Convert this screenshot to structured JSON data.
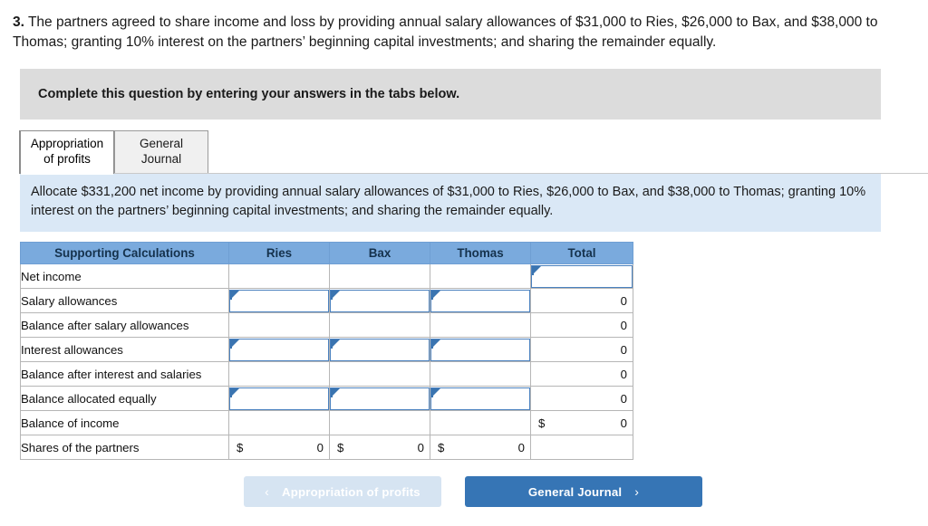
{
  "question": {
    "number": "3.",
    "text": "The partners agreed to share income and loss by providing annual salary allowances of $31,000 to Ries, $26,000 to Bax, and $38,000 to Thomas; granting 10% interest on the partners’ beginning capital investments; and sharing the remainder equally."
  },
  "banner": {
    "text": "Complete this question by entering your answers in the tabs below."
  },
  "tabs": [
    {
      "label_line1": "Appropriation",
      "label_line2": "of profits",
      "active": true
    },
    {
      "label_line1": "General",
      "label_line2": "Journal",
      "active": false
    }
  ],
  "instruction": {
    "text": "Allocate $331,200 net income by providing annual salary allowances of $31,000 to Ries, $26,000 to Bax, and $38,000 to Thomas; granting 10% interest on the partners’ beginning capital investments; and sharing the remainder equally."
  },
  "table": {
    "headers": [
      "Supporting Calculations",
      "Ries",
      "Bax",
      "Thomas",
      "Total"
    ],
    "rows": [
      {
        "label": "Net income",
        "ries": {
          "kind": "blank",
          "value": ""
        },
        "bax": {
          "kind": "blank",
          "value": ""
        },
        "thomas": {
          "kind": "blank",
          "value": ""
        },
        "total": {
          "kind": "input",
          "value": ""
        }
      },
      {
        "label": "Salary allowances",
        "ries": {
          "kind": "input",
          "value": ""
        },
        "bax": {
          "kind": "input",
          "value": ""
        },
        "thomas": {
          "kind": "input",
          "value": ""
        },
        "total": {
          "kind": "readonly",
          "value": "0"
        }
      },
      {
        "label": "Balance after salary allowances",
        "ries": {
          "kind": "blank",
          "value": ""
        },
        "bax": {
          "kind": "blank",
          "value": ""
        },
        "thomas": {
          "kind": "blank",
          "value": ""
        },
        "total": {
          "kind": "readonly",
          "value": "0",
          "underline": "dark"
        }
      },
      {
        "label": "Interest allowances",
        "ries": {
          "kind": "input",
          "value": ""
        },
        "bax": {
          "kind": "input",
          "value": ""
        },
        "thomas": {
          "kind": "input",
          "value": ""
        },
        "total": {
          "kind": "readonly",
          "value": "0"
        }
      },
      {
        "label": "Balance after interest and salaries",
        "ries": {
          "kind": "blank",
          "value": ""
        },
        "bax": {
          "kind": "blank",
          "value": ""
        },
        "thomas": {
          "kind": "blank",
          "value": ""
        },
        "total": {
          "kind": "readonly",
          "value": "0"
        }
      },
      {
        "label": "Balance allocated equally",
        "ries": {
          "kind": "input",
          "value": ""
        },
        "bax": {
          "kind": "input",
          "value": ""
        },
        "thomas": {
          "kind": "input",
          "value": ""
        },
        "total": {
          "kind": "readonly",
          "value": "0"
        }
      },
      {
        "label": "Balance of income",
        "ries": {
          "kind": "blank",
          "value": ""
        },
        "bax": {
          "kind": "blank",
          "value": ""
        },
        "thomas": {
          "kind": "blank",
          "value": ""
        },
        "total": {
          "kind": "money",
          "currency": "$",
          "value": "0",
          "underline": "dark"
        }
      },
      {
        "label": "Shares of the partners",
        "ries": {
          "kind": "money",
          "currency": "$",
          "value": "0",
          "underline": "dark"
        },
        "bax": {
          "kind": "money",
          "currency": "$",
          "value": "0",
          "underline": "dark"
        },
        "thomas": {
          "kind": "money",
          "currency": "$",
          "value": "0",
          "underline": "dark"
        },
        "total": {
          "kind": "blank",
          "value": ""
        }
      }
    ]
  },
  "footer": {
    "prev_label": "Appropriation of profits",
    "prev_chevron": "‹",
    "prev_enabled": false,
    "next_label": "General Journal",
    "next_chevron": "›",
    "next_enabled": true
  },
  "colors": {
    "header_blue": "#7aaadd",
    "instruction_blue": "#dae8f6",
    "banner_gray": "#dcdcdc",
    "input_border_blue": "#4a81bf",
    "primary_button": "#3675b5",
    "disabled_button": "#d6e4f2"
  }
}
